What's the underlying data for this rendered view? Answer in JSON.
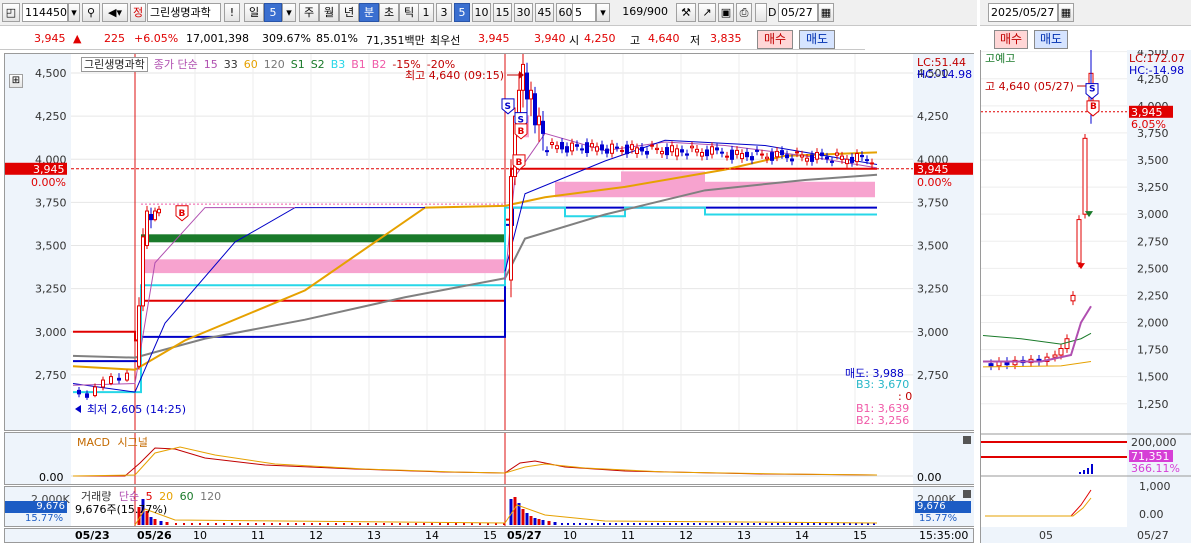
{
  "toolbar": {
    "code": "114450",
    "market_badge": "정",
    "name": "그린생명과학",
    "alert_label": "!",
    "period_day": "일",
    "period_value": "5",
    "period_week": "주",
    "period_month": "월",
    "period_year": "년",
    "period_min": "분",
    "period_sec": "초",
    "period_tick": "틱",
    "intervals": [
      "1",
      "3",
      "5",
      "10",
      "15",
      "30",
      "45",
      "60"
    ],
    "selected_interval": "5",
    "count_select": "5",
    "bar_count": "169",
    "bar_total": "/900",
    "date": "05/27",
    "date_prefix": "D"
  },
  "toolbar_right": {
    "date": "2025/05/27"
  },
  "quote": {
    "price": "3,945",
    "change": "225",
    "change_pct": "+6.05%",
    "volume": "17,001,398",
    "vol_ratio": "309.67%",
    "ratio2": "85.01%",
    "amount": "71,351백만",
    "best_label": "최우선",
    "ask": "3,945",
    "bid": "3,940",
    "open_label": "시",
    "open": "4,250",
    "high_label": "고",
    "high": "4,640",
    "low_label": "저",
    "low": "3,835",
    "buy_label": "매수",
    "sell_label": "매도"
  },
  "quote_right": {
    "buy_label": "매수",
    "sell_label": "매도"
  },
  "main_chart": {
    "legend": {
      "name": "그린생명과학",
      "ma_label": "종가 단순",
      "ma_periods": [
        "15",
        "33",
        "60",
        "120"
      ],
      "signals": [
        "S1",
        "S2",
        "B3",
        "B1",
        "B2"
      ],
      "pcts": [
        "-15%",
        "-20%"
      ]
    },
    "high_note": "최고 4,640 (09:15)",
    "low_note": "최저 2,605 (14:25)",
    "lc": "LC:51.44",
    "hc": "HC:-14.98",
    "price_tag": "3,945",
    "pct_tag": "0.00%",
    "price_tag_right": "3,945",
    "pct_tag_right": "0.00%",
    "y_labels": [
      "4,500",
      "4,250",
      "4,000",
      "3,750",
      "3,500",
      "3,250",
      "3,000",
      "2,750"
    ],
    "levels": {
      "sell_label": "매도: 3,988",
      "b3_label": "B3: 3,670",
      "zero_label": ": 0",
      "b1_label": "B1: 3,639",
      "b2_label": "B2: 3,256"
    }
  },
  "macd": {
    "title": "MACD",
    "signal": "시그널",
    "zero": "0.00",
    "zero_right": "0.00"
  },
  "volume": {
    "title": "거래량",
    "ma_label": "단순",
    "periods": [
      "5",
      "20",
      "60",
      "120"
    ],
    "detail": "9,676주(15.77%)",
    "y_top": "2,000K",
    "y_top_right": "2,000K",
    "tag_value": "9,676",
    "tag_pct": "15.77%",
    "tag_value_right": "9,676",
    "tag_pct_right": "15.77%"
  },
  "x_axis": {
    "labels": [
      "05/23",
      "05/26",
      "10",
      "11",
      "12",
      "13",
      "14",
      "15",
      "05/27",
      "10",
      "11",
      "12",
      "13",
      "14",
      "15"
    ],
    "time_right": "15:35:00"
  },
  "side_chart": {
    "title": "고예고",
    "high_note": "고 4,640 (05/27)",
    "lc": "LC:172.07",
    "hc": "HC:-14.98",
    "price_tag": "3,945",
    "pct_tag": "6.05%",
    "y_labels": [
      "4,500",
      "4,250",
      "4,000",
      "3,750",
      "3,500",
      "3,250",
      "3,000",
      "2,750",
      "2,500",
      "2,250",
      "2,000",
      "1,750",
      "1,500",
      "1,250"
    ],
    "vol_top": "200,000",
    "vol_tag": "71,351",
    "vol_pct": "366.11%",
    "ind_top": "1,000",
    "ind_zero": "0.00",
    "x_labels": [
      "05",
      "05/27"
    ]
  },
  "colors": {
    "up": "#e00000",
    "down": "#0000d0",
    "pink": "#f7a3cf",
    "green": "#1a7a2a",
    "gold": "#e6a100",
    "cyan": "#27d7e8"
  }
}
